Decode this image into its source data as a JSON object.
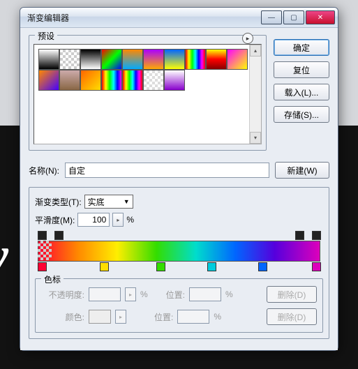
{
  "window": {
    "title": "渐变编辑器"
  },
  "presets": {
    "label": "预设"
  },
  "actions": {
    "ok": "确定",
    "reset": "复位",
    "load": "载入(L)...",
    "save": "存储(S)...",
    "new": "新建(W)"
  },
  "name": {
    "label": "名称(N):",
    "value": "自定"
  },
  "grad": {
    "type_label": "渐变类型(T):",
    "type_value": "实底",
    "smooth_label": "平滑度(M):",
    "smooth_value": "100",
    "smooth_unit": "%"
  },
  "stops": {
    "label": "色标",
    "opacity": "不透明度:",
    "opacity_unit": "%",
    "pos": "位置:",
    "pos_unit": "%",
    "color": "颜色:",
    "delete": "删除(D)"
  }
}
